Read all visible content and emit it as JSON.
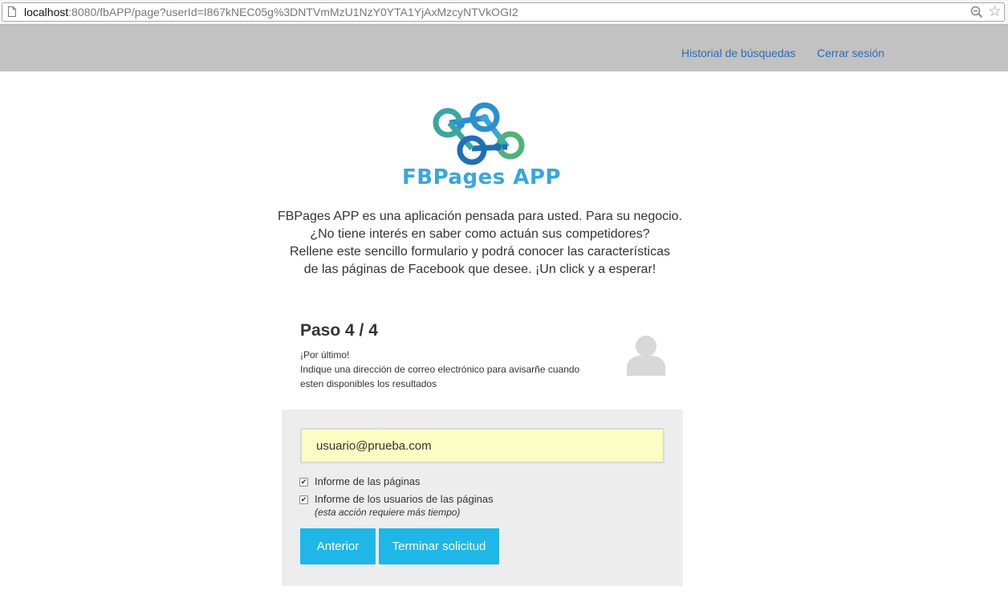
{
  "browser": {
    "url_host": "localhost",
    "url_rest": ":8080/fbAPP/page?userId=I867kNEC05g%3DNTVmMzU1NzY0YTA1YjAxMzcyNTVkOGI2",
    "icons": [
      "page-icon",
      "zoom-icon",
      "star-icon"
    ]
  },
  "nav": {
    "history_label": "Historial de búsquedas",
    "logout_label": "Cerrar sesión"
  },
  "logo": {
    "text": "FBPages APP",
    "colors": [
      "#2b8fd0",
      "#35a8dd",
      "#4fb27a",
      "#1f6fb5",
      "#3aa6a0"
    ]
  },
  "intro": {
    "lines": [
      "FBPages APP es una aplicación pensada para usted. Para su negocio.",
      "¿No tiene interés en saber como actuán sus competidores?",
      "Rellene este sencillo formulario y podrá conocer las características",
      "de las páginas de Facebook que desee. ¡Un click y a esperar!"
    ]
  },
  "step": {
    "title": "Paso 4 / 4",
    "desc_lines": [
      "¡Por último!",
      "Indique una dirección de correo electrónico para avisarñe cuando",
      "esten disponibles los resultados"
    ]
  },
  "form": {
    "email_value": "usuario@prueba.com",
    "checkboxes": [
      {
        "label": "Informe de las páginas",
        "checked": true
      },
      {
        "label": "Informe de los usuarios de las páginas",
        "checked": true
      }
    ],
    "note": "(esta acción requiere más tiempo)",
    "prev_label": "Anterior",
    "submit_label": "Terminar solicitud"
  },
  "colors": {
    "navbar": "#c2c2c2",
    "link": "#2a6db4",
    "button": "#1eb7e7",
    "email_bg": "#fbfdc3",
    "panel_bg": "#ededed"
  }
}
